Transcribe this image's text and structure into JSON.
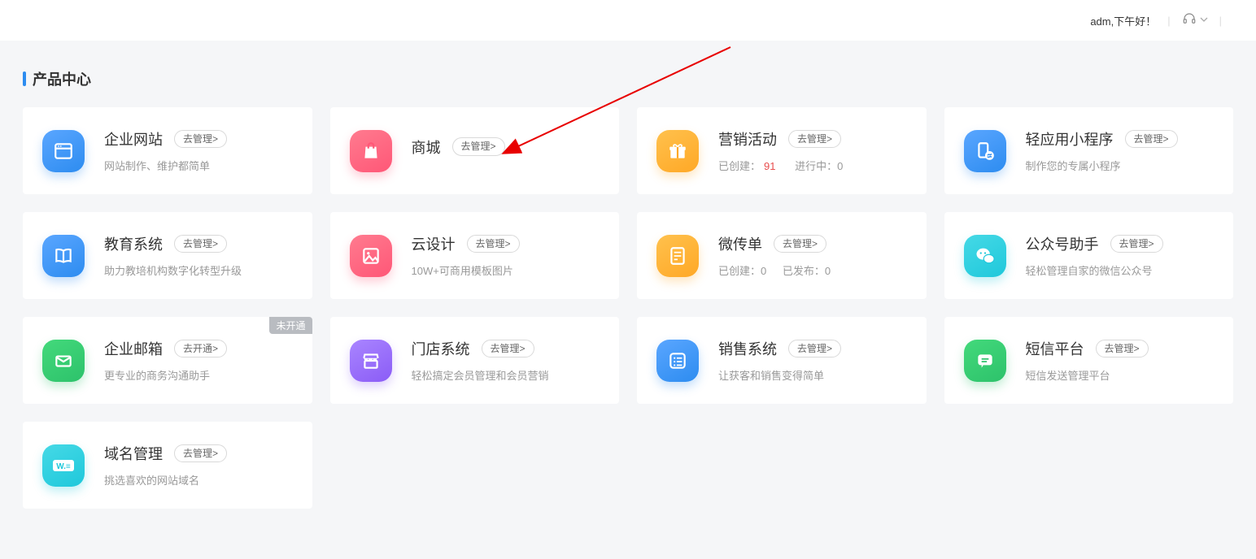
{
  "header": {
    "greeting": "adm,下午好！"
  },
  "section": {
    "title": "产品中心"
  },
  "btn": {
    "manage": "去管理>",
    "open": "去开通>"
  },
  "badge": {
    "notOpen": "未开通"
  },
  "cards": {
    "r1": {
      "c1": {
        "title": "企业网站",
        "desc": "网站制作、维护都简单"
      },
      "c2": {
        "title": "商城"
      },
      "c3": {
        "title": "营销活动",
        "created_label": "已创建：",
        "created_value": "91",
        "ongoing_label": "进行中：",
        "ongoing_value": "0"
      },
      "c4": {
        "title": "轻应用小程序",
        "desc": "制作您的专属小程序"
      }
    },
    "r2": {
      "c1": {
        "title": "教育系统",
        "desc": "助力教培机构数字化转型升级"
      },
      "c2": {
        "title": "云设计",
        "desc": "10W+可商用模板图片"
      },
      "c3": {
        "title": "微传单",
        "created_label": "已创建：",
        "created_value": "0",
        "published_label": "已发布：",
        "published_value": "0"
      },
      "c4": {
        "title": "公众号助手",
        "desc": "轻松管理自家的微信公众号"
      }
    },
    "r3": {
      "c1": {
        "title": "企业邮箱",
        "desc": "更专业的商务沟通助手"
      },
      "c2": {
        "title": "门店系统",
        "desc": "轻松搞定会员管理和会员营销"
      },
      "c3": {
        "title": "销售系统",
        "desc": "让获客和销售变得简单"
      },
      "c4": {
        "title": "短信平台",
        "desc": "短信发送管理平台"
      }
    },
    "r4": {
      "c1": {
        "title": "域名管理",
        "desc": "挑选喜欢的网站域名"
      }
    }
  }
}
